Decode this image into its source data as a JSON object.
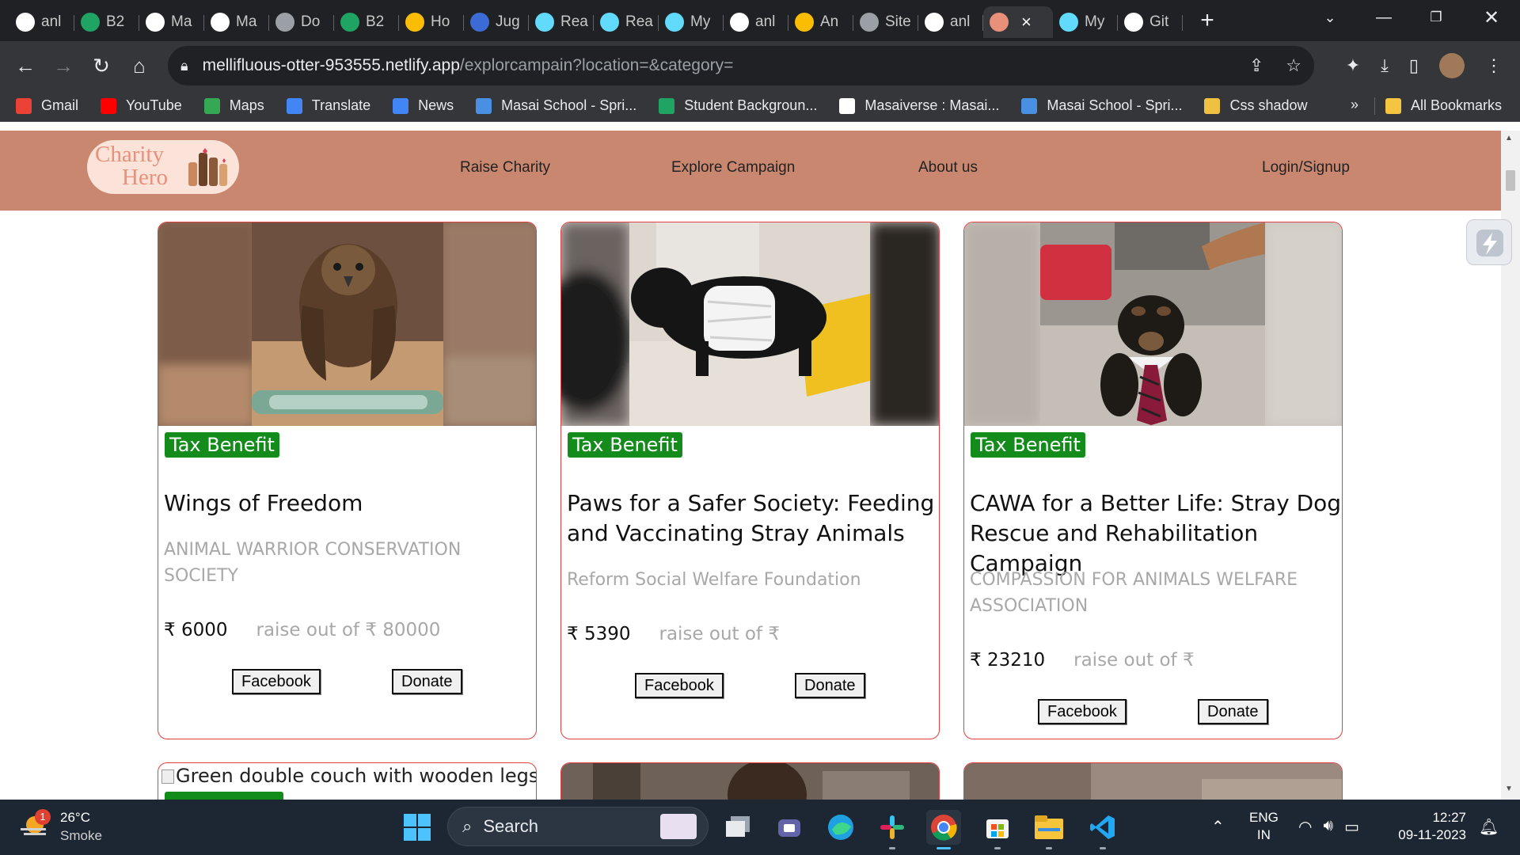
{
  "browser": {
    "tabs": [
      {
        "label": "anl",
        "icon": "github-icon",
        "color": "#ffffff"
      },
      {
        "label": "B2",
        "icon": "sheets-icon",
        "color": "#1fa463"
      },
      {
        "label": "Ma",
        "icon": "m-icon",
        "color": "#ffffff"
      },
      {
        "label": "Ma",
        "icon": "m-icon",
        "color": "#ffffff"
      },
      {
        "label": "Do",
        "icon": "globe-icon",
        "color": "#9aa0a6"
      },
      {
        "label": "B2",
        "icon": "sheets-icon",
        "color": "#1fa463"
      },
      {
        "label": "Ho",
        "icon": "drive-icon",
        "color": "#fbbc04"
      },
      {
        "label": "Jug",
        "icon": "j-icon",
        "color": "#3c6bd6"
      },
      {
        "label": "Rea",
        "icon": "react-icon",
        "color": "#61dafb"
      },
      {
        "label": "Rea",
        "icon": "react-icon",
        "color": "#61dafb"
      },
      {
        "label": "My",
        "icon": "react-icon",
        "color": "#61dafb"
      },
      {
        "label": "anl",
        "icon": "github-icon",
        "color": "#ffffff"
      },
      {
        "label": "An",
        "icon": "drive-icon",
        "color": "#fbbc04"
      },
      {
        "label": "Site",
        "icon": "globe-icon",
        "color": "#9aa0a6"
      },
      {
        "label": "anl",
        "icon": "github-icon",
        "color": "#ffffff"
      },
      {
        "label": "",
        "icon": "charity-icon",
        "color": "#e8907a",
        "active": true
      },
      {
        "label": "My",
        "icon": "react-icon",
        "color": "#61dafb"
      },
      {
        "label": "Git",
        "icon": "github-icon",
        "color": "#ffffff"
      }
    ],
    "url_host": "mellifluous-otter-953555.netlify.app",
    "url_path": "/explorcampain?location=&category=",
    "bookmarks": [
      {
        "label": "Gmail",
        "icon": "gmail-icon",
        "color": "#ea4335"
      },
      {
        "label": "YouTube",
        "icon": "youtube-icon",
        "color": "#ff0000"
      },
      {
        "label": "Maps",
        "icon": "maps-icon",
        "color": "#34a853"
      },
      {
        "label": "Translate",
        "icon": "translate-icon",
        "color": "#4285f4"
      },
      {
        "label": "News",
        "icon": "news-icon",
        "color": "#4285f4"
      },
      {
        "label": "Masai School - Spri...",
        "icon": "masai-icon",
        "color": "#4a90e2"
      },
      {
        "label": "Student Backgroun...",
        "icon": "sheets-icon",
        "color": "#1fa463"
      },
      {
        "label": "Masaiverse : Masai...",
        "icon": "masaiverse-icon",
        "color": "#ffffff"
      },
      {
        "label": "Masai School - Spri...",
        "icon": "masai-icon",
        "color": "#4a90e2"
      },
      {
        "label": "Css shadow",
        "icon": "css-icon",
        "color": "#f0c040"
      }
    ],
    "more_bookmarks": "»",
    "all_bookmarks": "All Bookmarks"
  },
  "site": {
    "logo_line1": "Charity",
    "logo_line2": "Hero",
    "nav": {
      "raise": "Raise Charity",
      "explore": "Explore Campaign",
      "about": "About us",
      "login": "Login/Signup"
    },
    "campaigns": [
      {
        "badge": "Tax Benefit",
        "title": "Wings of Freedom",
        "org": "ANIMAL WARRIOR CONSERVATION SOCIETY",
        "raised": "₹ 6000",
        "goal": "raise out of ₹ 80000",
        "facebook": "Facebook",
        "donate": "Donate",
        "image": "eagle"
      },
      {
        "badge": "Tax Benefit",
        "title": "Paws for a Safer Society: Feeding and Vaccinating Stray Animals",
        "org": "Reform Social Welfare Foundation",
        "raised": "₹ 5390",
        "goal": "raise out of ₹",
        "facebook": "Facebook",
        "donate": "Donate",
        "image": "puppy-bandage"
      },
      {
        "badge": "Tax Benefit",
        "title": "CAWA for a Better Life: Stray Dog Rescue and Rehabilitation Campaign",
        "org": "COMPASSION FOR ANIMALS WELFARE ASSOCIATION",
        "raised": "₹ 23210",
        "goal": "raise out of ₹",
        "facebook": "Facebook",
        "donate": "Donate",
        "image": "puppy-tie"
      }
    ],
    "next_row": {
      "broken_alt": "Green double couch with wooden legs"
    }
  },
  "taskbar": {
    "weather_temp": "26°C",
    "weather_desc": "Smoke",
    "weather_badge": "1",
    "search": "Search",
    "lang_line1": "ENG",
    "lang_line2": "IN",
    "time": "12:27",
    "date": "09-11-2023"
  },
  "colors": {
    "nav_bg": "#c98770",
    "badge_green": "#148c1c",
    "card_border": "#e04040",
    "muted_text": "#a8a8a8"
  }
}
